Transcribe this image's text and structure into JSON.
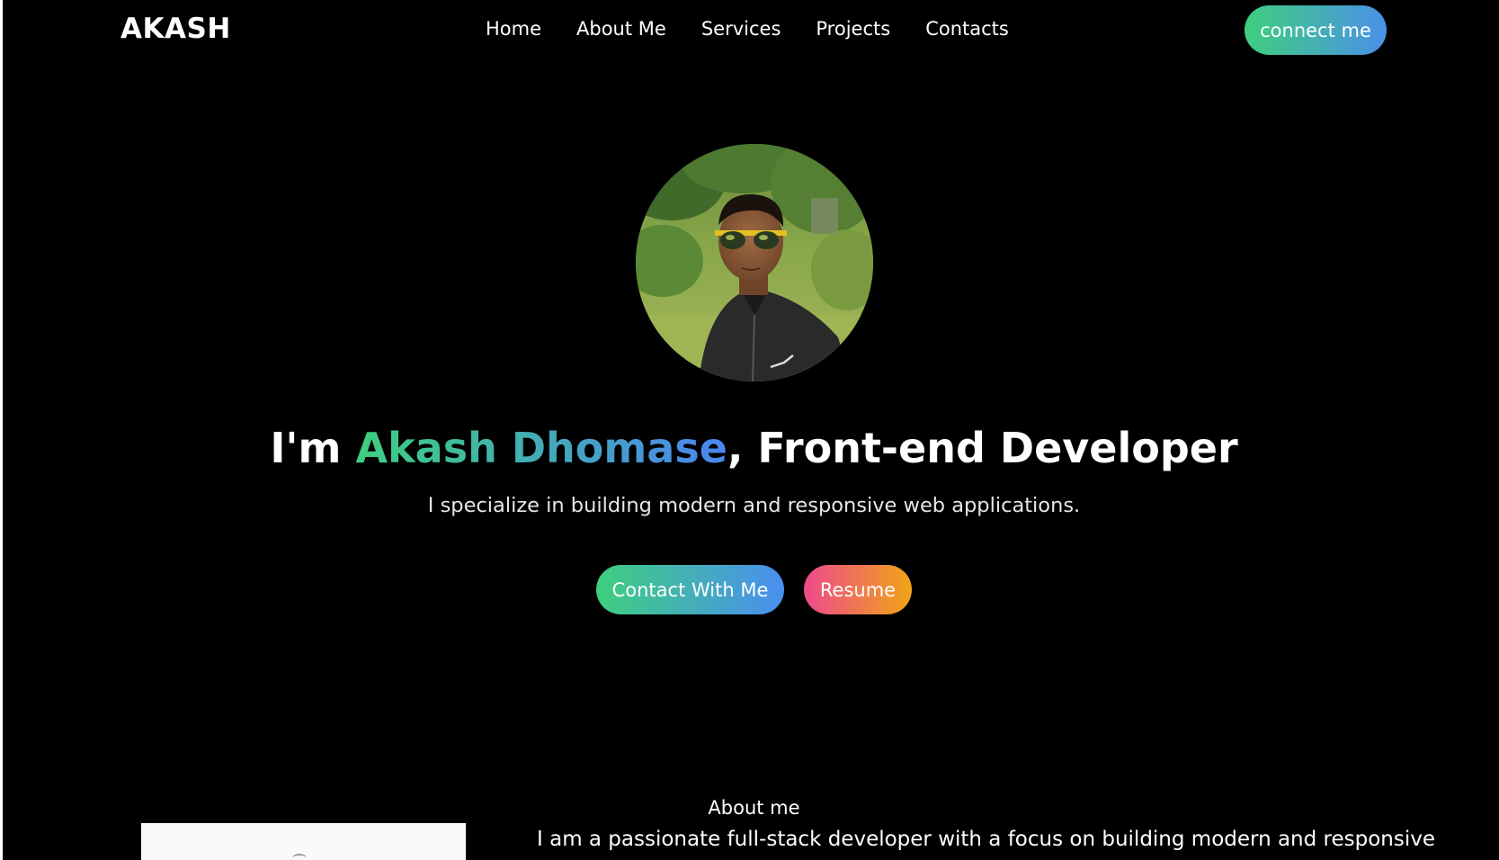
{
  "header": {
    "logo": "AKASH",
    "nav": [
      {
        "label": "Home"
      },
      {
        "label": "About Me"
      },
      {
        "label": "Services"
      },
      {
        "label": "Projects"
      },
      {
        "label": "Contacts"
      }
    ],
    "connect_label": "connect me"
  },
  "hero": {
    "headline_prefix": "I'm ",
    "headline_name": "Akash Dhomase",
    "headline_suffix": ", Front-end Developer",
    "subtitle": "I specialize in building modern and responsive web applications.",
    "contact_button": "Contact With Me",
    "resume_button": "Resume"
  },
  "about": {
    "heading": "About me",
    "text": "I am a passionate full-stack developer with a focus on building modern and responsive"
  },
  "colors": {
    "background": "#000000",
    "accent_green": "#3ecf7e",
    "accent_blue": "#4a8ef0",
    "accent_pink": "#ee4a8c",
    "accent_orange": "#f0a516"
  },
  "icons": {
    "avatar": "profile-photo"
  }
}
